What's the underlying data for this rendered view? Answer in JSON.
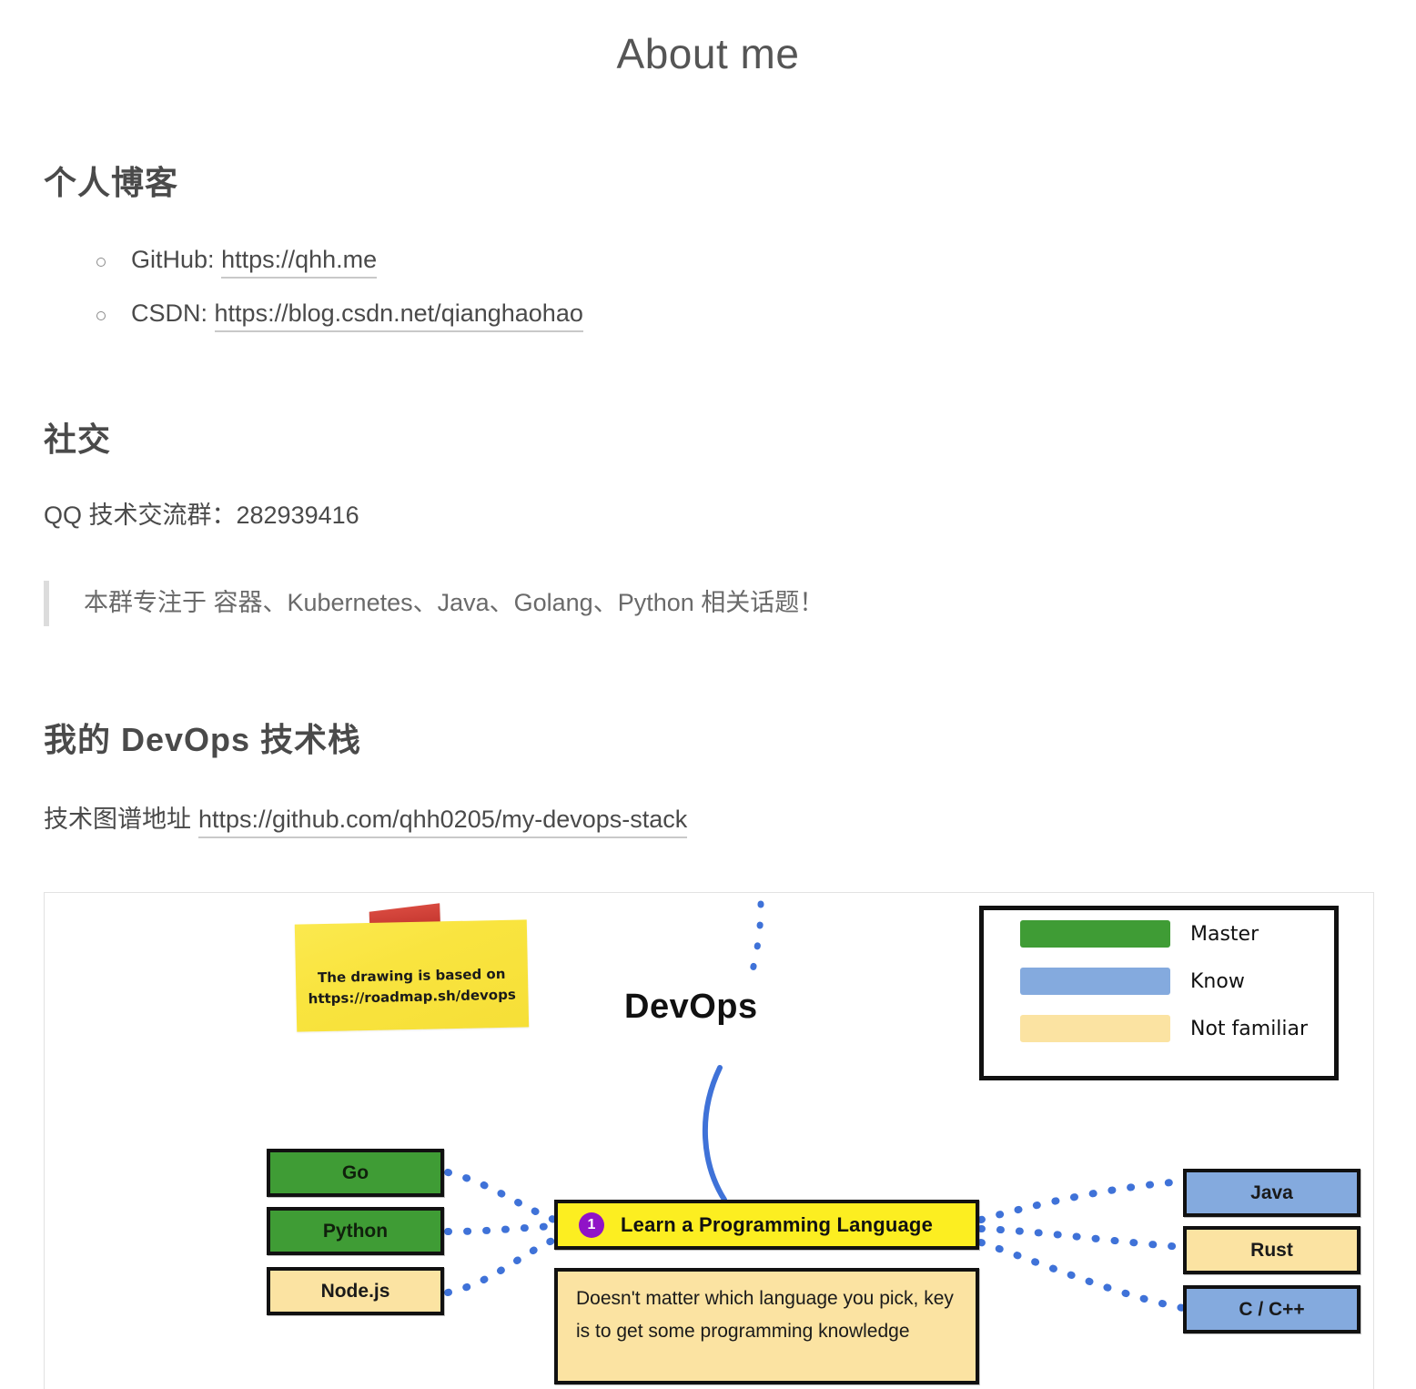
{
  "page": {
    "title": "About me"
  },
  "sections": {
    "blog": {
      "heading": "个人博客",
      "links": [
        {
          "label": "GitHub:",
          "url_text": "https://qhh.me"
        },
        {
          "label": "CSDN:",
          "url_text": "https://blog.csdn.net/qianghaohao"
        }
      ]
    },
    "social": {
      "heading": "社交",
      "qq_line": "QQ 技术交流群：282939416",
      "quote": "本群专注于 容器、Kubernetes、Java、Golang、Python 相关话题！"
    },
    "devops": {
      "heading": "我的 DevOps 技术栈",
      "stack_prefix": "技术图谱地址",
      "stack_url_text": "https://github.com/qhh0205/my-devops-stack"
    }
  },
  "diagram": {
    "sticky_note": {
      "line1": "The drawing is based on",
      "line2": "https://roadmap.sh/devops"
    },
    "root_label": "DevOps",
    "legend": {
      "items": [
        {
          "label": "Master",
          "color": "#3f9c35"
        },
        {
          "label": "Know",
          "color": "#84aade"
        },
        {
          "label": "Not familiar",
          "color": "#fbe3a2"
        }
      ]
    },
    "center_node": {
      "number": "1",
      "label": "Learn a Programming Language",
      "badge_color": "#9013c7",
      "fill": "#fcee21"
    },
    "description_node": {
      "text": "Doesn't matter which language you pick, key is to get some programming knowledge",
      "fill": "#fbe3a2"
    },
    "left_nodes": [
      {
        "label": "Go",
        "level": "Master",
        "fill": "#3f9c35"
      },
      {
        "label": "Python",
        "level": "Master",
        "fill": "#3f9c35"
      },
      {
        "label": "Node.js",
        "level": "Not familiar",
        "fill": "#fbe3a2"
      }
    ],
    "right_nodes": [
      {
        "label": "Java",
        "level": "Know",
        "fill": "#84aade"
      },
      {
        "label": "Rust",
        "level": "Not familiar",
        "fill": "#fbe3a2"
      },
      {
        "label": "C / C++",
        "level": "Know",
        "fill": "#84aade"
      }
    ],
    "connector_color": "#3f72d8"
  }
}
